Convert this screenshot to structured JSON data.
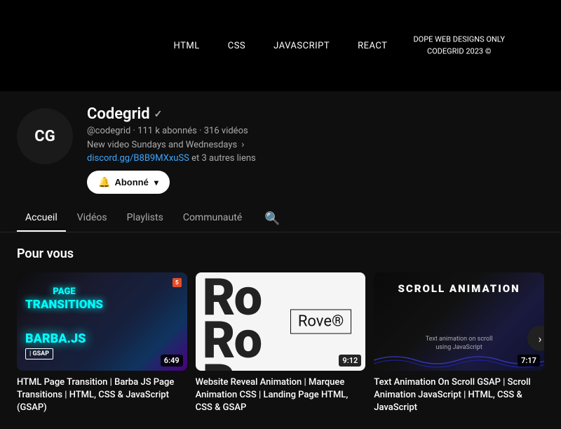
{
  "banner": {
    "nav_items": [
      "HTML",
      "CSS",
      "JAVASCRIPT",
      "REACT"
    ],
    "right_text_line1": "DOPE WEB DESIGNS ONLY",
    "right_text_line2": "CODEGRID 2023 ©"
  },
  "channel": {
    "avatar_text": "CG",
    "name": "Codegrid",
    "handle": "@codegrid",
    "subscribers": "111 k abonnés",
    "videos_count": "316 vidéos",
    "description": "New video Sundays and Wednesdays",
    "link_url": "discord.gg/B8B9MXxuSS",
    "link_extra": "et 3 autres liens",
    "subscribe_label": "Abonné"
  },
  "tabs": {
    "items": [
      "Accueil",
      "Vidéos",
      "Playlists",
      "Communauté"
    ],
    "active": "Accueil"
  },
  "section": {
    "title": "Pour vous"
  },
  "videos": [
    {
      "title": "HTML Page Transition | Barba JS Page Transitions | HTML, CSS & JavaScript (GSAP)",
      "duration": "6:49",
      "thumb_type": "page-transitions"
    },
    {
      "title": "Website Reveal Animation | Marquee Animation CSS | Landing Page HTML, CSS & GSAP",
      "duration": "9:12",
      "thumb_type": "rove"
    },
    {
      "title": "Text Animation On Scroll GSAP | Scroll Animation JavaScript | HTML, CSS & JavaScript",
      "duration": "7:17",
      "thumb_type": "scroll-animation"
    }
  ]
}
